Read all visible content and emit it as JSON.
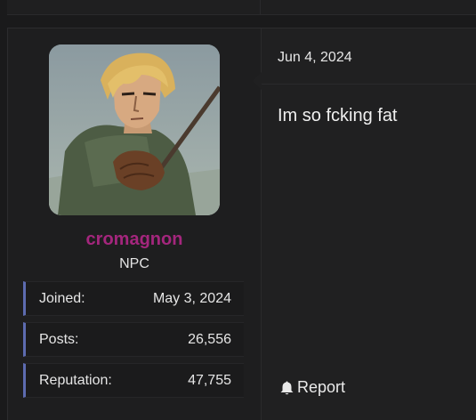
{
  "user": {
    "name": "cromagnon",
    "title": "NPC",
    "name_color": "#a4267d"
  },
  "stats": [
    {
      "label": "Joined:",
      "value": "May 3, 2024"
    },
    {
      "label": "Posts:",
      "value": "26,556"
    },
    {
      "label": "Reputation:",
      "value": "47,755"
    }
  ],
  "post": {
    "date": "Jun 4, 2024",
    "body": "Im so fcking fat",
    "report_label": "Report"
  },
  "icons": {
    "report": "bell-icon"
  },
  "colors": {
    "background": "#1a1a1b",
    "stat_accent": "#5d6bb0"
  }
}
